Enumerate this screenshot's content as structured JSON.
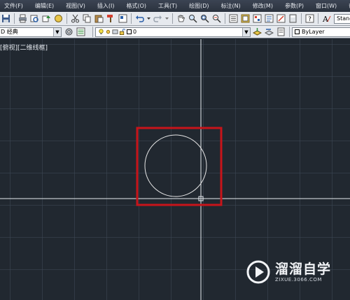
{
  "menubar": {
    "items": [
      "文件(F)",
      "编辑(E)",
      "视图(V)",
      "插入(I)",
      "格式(O)",
      "工具(T)",
      "绘图(D)",
      "标注(N)",
      "修改(M)",
      "参数(P)",
      "窗口(W)",
      "帮"
    ]
  },
  "toolbar_standard": {
    "text_style_value": "Standard"
  },
  "toolbar_layers": {
    "workspace_value": "D 经典",
    "layer_value": "0",
    "color_value": "ByLayer"
  },
  "viewport": {
    "label": "[俯视][二维线框]"
  },
  "watermark": {
    "title": "溜溜自学",
    "url": "ZIXUE.3066.COM"
  },
  "colors": {
    "canvas_background": "#212830",
    "crosshair": "#e8ecf0",
    "circle": "#e6e6e6",
    "highlight_box": "#c8141a",
    "menubar": "#2f3743",
    "toolbar": "#e6e9ee"
  }
}
